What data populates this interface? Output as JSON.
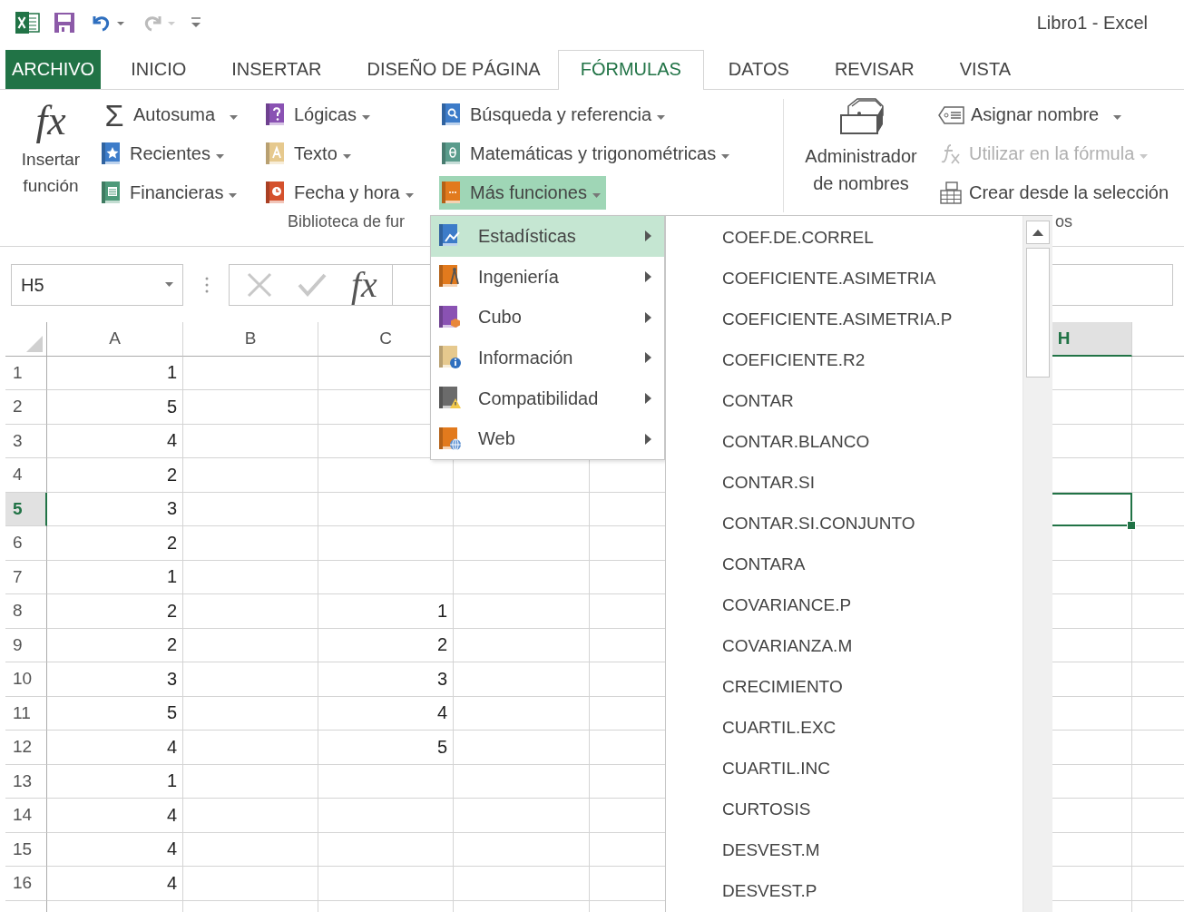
{
  "title_bar": {
    "title": "Libro1 - Excel"
  },
  "tabs": [
    {
      "label": "ARCHIVO",
      "kind": "file",
      "selected": false
    },
    {
      "label": "INICIO",
      "kind": "tab",
      "selected": false
    },
    {
      "label": "INSERTAR",
      "kind": "tab",
      "selected": false
    },
    {
      "label": "DISEÑO DE PÁGINA",
      "kind": "tab",
      "selected": false
    },
    {
      "label": "FÓRMULAS",
      "kind": "tab",
      "selected": true
    },
    {
      "label": "DATOS",
      "kind": "tab",
      "selected": false
    },
    {
      "label": "REVISAR",
      "kind": "tab",
      "selected": false
    },
    {
      "label": "VISTA",
      "kind": "tab",
      "selected": false
    }
  ],
  "ribbon": {
    "function_library": {
      "insert_function": {
        "glyph": "fx",
        "label": "Insertar función"
      },
      "columns": [
        [
          {
            "label": "Autosuma",
            "glyph": "Σ",
            "dropdown": true,
            "highlighted": false
          },
          {
            "label": "Recientes",
            "dropdown": true,
            "highlighted": false
          },
          {
            "label": "Financieras",
            "dropdown": true,
            "highlighted": false
          }
        ],
        [
          {
            "label": "Lógicas",
            "dropdown": true,
            "highlighted": false
          },
          {
            "label": "Texto",
            "dropdown": true,
            "highlighted": false
          },
          {
            "label": "Fecha y hora",
            "dropdown": true,
            "highlighted": false
          }
        ],
        [
          {
            "label": "Búsqueda y referencia",
            "dropdown": true,
            "highlighted": false
          },
          {
            "label": "Matemáticas y trigonométricas",
            "dropdown": true,
            "highlighted": false
          },
          {
            "label": "Más funciones",
            "dropdown": true,
            "highlighted": true
          }
        ]
      ],
      "group_label": "Biblioteca de fur"
    },
    "defined_names": {
      "name_manager": {
        "label": "Administrador de nombres"
      },
      "items": [
        {
          "label": "Asignar nombre",
          "dropdown": true,
          "disabled": false
        },
        {
          "label": "Utilizar en la fórmula",
          "dropdown": true,
          "disabled": true
        },
        {
          "label": "Crear desde la selección",
          "dropdown": false,
          "disabled": false
        }
      ],
      "group_label": "os"
    }
  },
  "formula_bar": {
    "name_box": "H5",
    "function_glyph": "fx"
  },
  "sheet": {
    "columns": [
      {
        "label": "A",
        "selected": false
      },
      {
        "label": "B",
        "selected": false
      },
      {
        "label": "C",
        "selected": false
      },
      {
        "label": "H",
        "selected": true
      }
    ],
    "rows": [
      {
        "number": "1",
        "selected": false,
        "A": "1"
      },
      {
        "number": "2",
        "selected": false,
        "A": "5"
      },
      {
        "number": "3",
        "selected": false,
        "A": "4"
      },
      {
        "number": "4",
        "selected": false,
        "A": "2"
      },
      {
        "number": "5",
        "selected": true,
        "A": "3"
      },
      {
        "number": "6",
        "selected": false,
        "A": "2"
      },
      {
        "number": "7",
        "selected": false,
        "A": "1"
      },
      {
        "number": "8",
        "selected": false,
        "A": "2",
        "C": "1"
      },
      {
        "number": "9",
        "selected": false,
        "A": "2",
        "C": "2"
      },
      {
        "number": "10",
        "selected": false,
        "A": "3",
        "C": "3"
      },
      {
        "number": "11",
        "selected": false,
        "A": "5",
        "C": "4"
      },
      {
        "number": "12",
        "selected": false,
        "A": "4",
        "C": "5"
      },
      {
        "number": "13",
        "selected": false,
        "A": "1"
      },
      {
        "number": "14",
        "selected": false,
        "A": "4"
      },
      {
        "number": "15",
        "selected": false,
        "A": "4"
      },
      {
        "number": "16",
        "selected": false,
        "A": "4"
      }
    ]
  },
  "more_functions_menu": {
    "items": [
      {
        "label": "Estadísticas",
        "selected": true
      },
      {
        "label": "Ingeniería",
        "selected": false
      },
      {
        "label": "Cubo",
        "selected": false
      },
      {
        "label": "Información",
        "selected": false
      },
      {
        "label": "Compatibilidad",
        "selected": false
      },
      {
        "label": "Web",
        "selected": false
      }
    ]
  },
  "function_list": {
    "items": [
      "COEF.DE.CORREL",
      "COEFICIENTE.ASIMETRIA",
      "COEFICIENTE.ASIMETRIA.P",
      "COEFICIENTE.R2",
      "CONTAR",
      "CONTAR.BLANCO",
      "CONTAR.SI",
      "CONTAR.SI.CONJUNTO",
      "CONTARA",
      "COVARIANCE.P",
      "COVARIANZA.M",
      "CRECIMIENTO",
      "CUARTIL.EXC",
      "CUARTIL.INC",
      "CURTOSIS",
      "DESVEST.M",
      "DESVEST.P"
    ]
  }
}
